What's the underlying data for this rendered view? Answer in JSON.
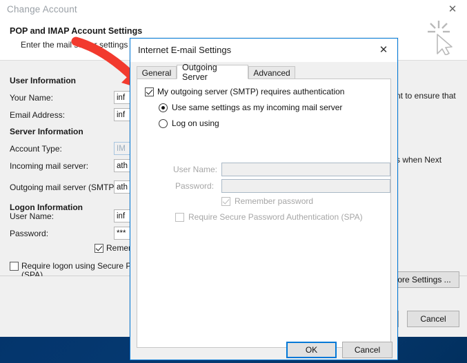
{
  "background_window": {
    "title": "Change Account",
    "close_icon": "close-icon",
    "heading": "POP and IMAP Account Settings",
    "subheading": "Enter the mail server settings for your account.",
    "groups": {
      "user_information": "User Information",
      "server_information": "Server Information",
      "logon_information": "Logon Information"
    },
    "fields": [
      {
        "label": "Your Name:",
        "value": "inf"
      },
      {
        "label": "Email Address:",
        "value": "inf"
      },
      {
        "label": "Account Type:",
        "value": "IM"
      },
      {
        "label": "Incoming mail server:",
        "value": "ath"
      },
      {
        "label": "Outgoing mail server (SMTP):",
        "value": "ath"
      },
      {
        "label": "User Name:",
        "value": "inf"
      },
      {
        "label": "Password:",
        "value": "***"
      }
    ],
    "remember_password_label": "Remer",
    "remember_password_checked": true,
    "spa_label": "Require logon using Secure Pa",
    "spa_label_2": "(SPA)",
    "spa_checked": false,
    "right_texts": {
      "test_hint": "nt to ensure that",
      "next_hint": "s when Next"
    },
    "more_settings_label": "ore Settings ...",
    "cancel_label": "Cancel"
  },
  "dialog": {
    "title": "Internet E-mail Settings",
    "close_icon": "close-icon",
    "tabs": [
      {
        "label": "General",
        "active": false
      },
      {
        "label": "Outgoing Server",
        "active": true
      },
      {
        "label": "Advanced",
        "active": false
      }
    ],
    "smtp_auth": {
      "label": "My outgoing server (SMTP) requires authentication",
      "checked": true
    },
    "radios": [
      {
        "label": "Use same settings as my incoming mail server",
        "selected": true
      },
      {
        "label": "Log on using",
        "selected": false
      }
    ],
    "credentials": [
      {
        "label": "User Name:",
        "value": "",
        "disabled": true
      },
      {
        "label": "Password:",
        "value": "",
        "disabled": true
      }
    ],
    "remember_password": {
      "label": "Remember password",
      "checked": true,
      "disabled": true
    },
    "spa": {
      "label": "Require Secure Password Authentication (SPA)",
      "checked": false,
      "disabled": true
    },
    "buttons": {
      "ok": "OK",
      "cancel": "Cancel"
    }
  },
  "annotation": {
    "arrow_color": "#f23a2e",
    "arrow_name": "red-pointer-arrow"
  },
  "cursor": {
    "name": "click-cursor"
  },
  "colors": {
    "accent": "#0078d7",
    "desktop": "#04356c",
    "window_bg": "#f0f0f0"
  }
}
